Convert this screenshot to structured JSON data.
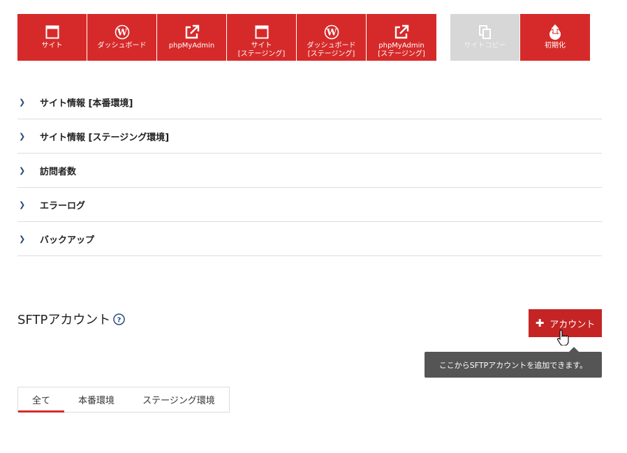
{
  "toolbar": {
    "main_buttons": [
      {
        "label": "サイト",
        "icon": "browser-window-icon"
      },
      {
        "label": "ダッシュボード",
        "icon": "wordpress-icon"
      },
      {
        "label": "phpMyAdmin",
        "icon": "external-link-icon"
      },
      {
        "label": "サイト\n[ステージング]",
        "icon": "browser-window-icon"
      },
      {
        "label": "ダッシュボード\n[ステージング]",
        "icon": "wordpress-icon"
      },
      {
        "label": "phpMyAdmin\n[ステージング]",
        "icon": "external-link-icon"
      }
    ],
    "site_copy_label": "サイトコピー",
    "initialize_label": "初期化"
  },
  "accordion": [
    {
      "label": "サイト情報 [本番環境]"
    },
    {
      "label": "サイト情報 [ステージング環境]"
    },
    {
      "label": "訪問者数"
    },
    {
      "label": "エラーログ"
    },
    {
      "label": "バックアップ"
    }
  ],
  "sftp": {
    "title": "SFTPアカウント",
    "add_button_label": "アカウント",
    "tooltip": "ここからSFTPアカウントを追加できます。"
  },
  "tabs": [
    {
      "label": "全て",
      "active": true
    },
    {
      "label": "本番環境",
      "active": false
    },
    {
      "label": "ステージング環境",
      "active": false
    }
  ],
  "colors": {
    "brand_red": "#d62a2a",
    "button_red": "#c52424",
    "disabled_gray": "#d7d7d7",
    "tooltip_bg": "#555555",
    "chevron_navy": "#2a4a7a"
  }
}
